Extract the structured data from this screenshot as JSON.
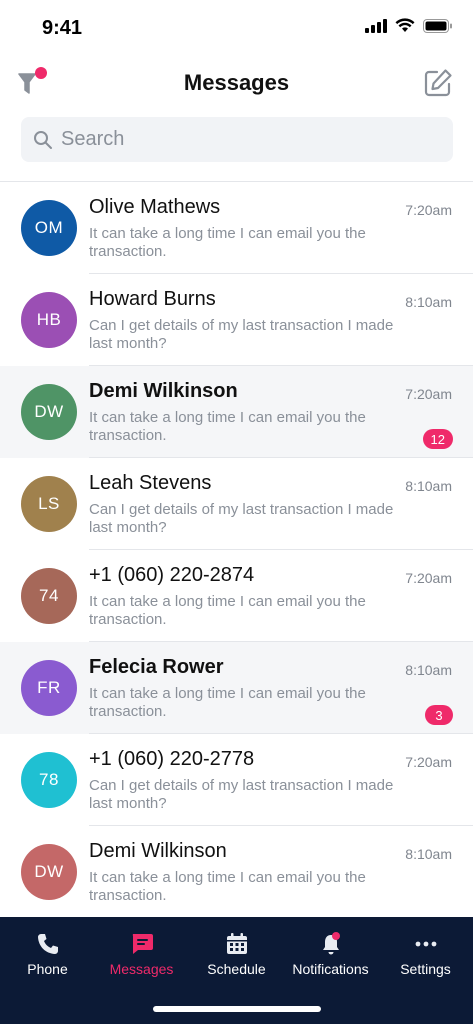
{
  "status_bar": {
    "time": "9:41"
  },
  "header": {
    "title": "Messages"
  },
  "search": {
    "placeholder": "Search"
  },
  "colors": {
    "accent": "#ef2a6a",
    "tabbar_bg": "#0c1a36"
  },
  "conversations": [
    {
      "initials": "OM",
      "name": "Olive Mathews",
      "time": "7:20am",
      "preview": "It can take a long time I can email you the transaction.",
      "color": "#0f5aa6",
      "unread": false,
      "badge": ""
    },
    {
      "initials": "HB",
      "name": "Howard Burns",
      "time": "8:10am",
      "preview": "Can I get details of my last transaction I made last month?",
      "color": "#9b4fb4",
      "unread": false,
      "badge": ""
    },
    {
      "initials": "DW",
      "name": "Demi Wilkinson",
      "time": "7:20am",
      "preview": "It can take a long time I can email you the transaction.",
      "color": "#4f9466",
      "unread": true,
      "badge": "12"
    },
    {
      "initials": "LS",
      "name": "Leah Stevens",
      "time": "8:10am",
      "preview": "Can I get details of my last transaction I made last month?",
      "color": "#a0814d",
      "unread": false,
      "badge": ""
    },
    {
      "initials": "74",
      "name": "+1 (060) 220-2874",
      "time": "7:20am",
      "preview": "It can take a long time I can email you the transaction.",
      "color": "#a66859",
      "unread": false,
      "badge": ""
    },
    {
      "initials": "FR",
      "name": "Felecia Rower",
      "time": "8:10am",
      "preview": "It can take a long time I can email you the transaction.",
      "color": "#8a5bd0",
      "unread": true,
      "badge": "3"
    },
    {
      "initials": "78",
      "name": "+1 (060) 220-2778",
      "time": "7:20am",
      "preview": "Can I get details of my last transaction I made last month?",
      "color": "#1fc0d2",
      "unread": false,
      "badge": ""
    },
    {
      "initials": "DW",
      "name": "Demi Wilkinson",
      "time": "8:10am",
      "preview": "It can take a long time I can email you the transaction.",
      "color": "#c46868",
      "unread": false,
      "badge": ""
    }
  ],
  "tabs": [
    {
      "label": "Phone",
      "icon": "phone-icon",
      "active": false
    },
    {
      "label": "Messages",
      "icon": "message-icon",
      "active": true
    },
    {
      "label": "Schedule",
      "icon": "calendar-icon",
      "active": false
    },
    {
      "label": "Notifications",
      "icon": "bell-icon",
      "active": false
    },
    {
      "label": "Settings",
      "icon": "more-icon",
      "active": false
    }
  ]
}
